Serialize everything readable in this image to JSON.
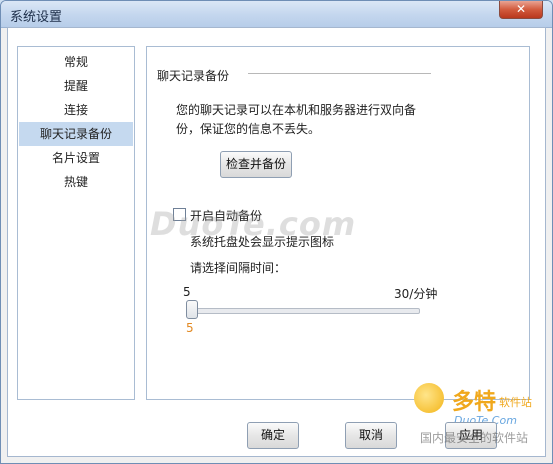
{
  "window": {
    "title": "系统设置",
    "close_glyph": "✕"
  },
  "sidebar": {
    "items": [
      {
        "label": "常规"
      },
      {
        "label": "提醒"
      },
      {
        "label": "连接"
      },
      {
        "label": "聊天记录备份",
        "active": true
      },
      {
        "label": "名片设置"
      },
      {
        "label": "热键"
      }
    ]
  },
  "panel": {
    "section_title": "聊天记录备份",
    "description": "您的聊天记录可以在本机和服务器进行双向备份，保证您的信息不丢失。",
    "check_button": "检查并备份",
    "auto_backup_label": "开启自动备份",
    "auto_backup_checked": false,
    "tray_hint": "系统托盘处会显示提示图标",
    "interval_label": "请选择间隔时间：",
    "slider": {
      "min_label": "5",
      "max_label": "30/分钟",
      "current_label": "5",
      "value": 5
    }
  },
  "footer": {
    "ok_label": "确定",
    "cancel_label": "取消",
    "apply_label": "应用"
  },
  "watermark": {
    "text": "DuoTe.com",
    "logo_big": "多特",
    "logo_small": "软件站",
    "logo_url": "DuoTe.Com",
    "logo_sub": "国内最安全的软件站"
  },
  "colors": {
    "accent_active": "#c5d9ef",
    "slider_value": "#e28a24"
  }
}
